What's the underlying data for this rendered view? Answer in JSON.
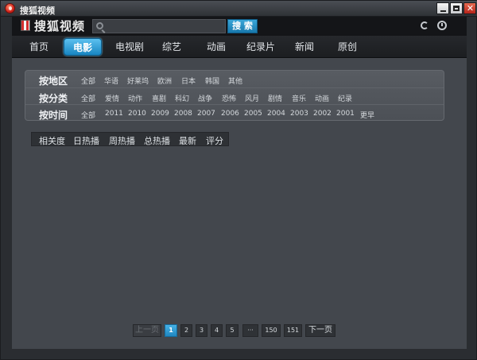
{
  "window": {
    "title": "搜狐视频"
  },
  "header": {
    "brand": "搜狐视频",
    "search": {
      "placeholder": "",
      "button_label": "搜 索"
    }
  },
  "nav": {
    "tabs": [
      {
        "label": "首页"
      },
      {
        "label": "电影",
        "active": true
      },
      {
        "label": "电视剧"
      },
      {
        "label": "综艺"
      },
      {
        "label": "动画"
      },
      {
        "label": "纪录片"
      },
      {
        "label": "新闻"
      },
      {
        "label": "原创"
      }
    ]
  },
  "filters": {
    "region": {
      "label": "按地区",
      "options": [
        "全部",
        "华语",
        "好莱坞",
        "欧洲",
        "日本",
        "韩国",
        "其他"
      ]
    },
    "category": {
      "label": "按分类",
      "options": [
        "全部",
        "爱情",
        "动作",
        "喜剧",
        "科幻",
        "战争",
        "恐怖",
        "风月",
        "剧情",
        "音乐",
        "动画",
        "纪录"
      ]
    },
    "time": {
      "label": "按时间",
      "options": [
        "全部",
        "2011",
        "2010",
        "2009",
        "2008",
        "2007",
        "2006",
        "2005",
        "2004",
        "2003",
        "2002",
        "2001",
        "更早"
      ]
    }
  },
  "sort": {
    "options": [
      "相关度",
      "日热播",
      "周热播",
      "总热播",
      "最新",
      "评分"
    ]
  },
  "pagination": {
    "prev_label": "上一页",
    "pages": [
      "1",
      "2",
      "3",
      "4",
      "5"
    ],
    "ellipsis": "···",
    "tail_pages": [
      "150",
      "151"
    ],
    "next_label": "下一页",
    "current_page": "1"
  },
  "colors": {
    "accent": "#1f86c0",
    "background": "#43474d",
    "header": "#141518"
  }
}
